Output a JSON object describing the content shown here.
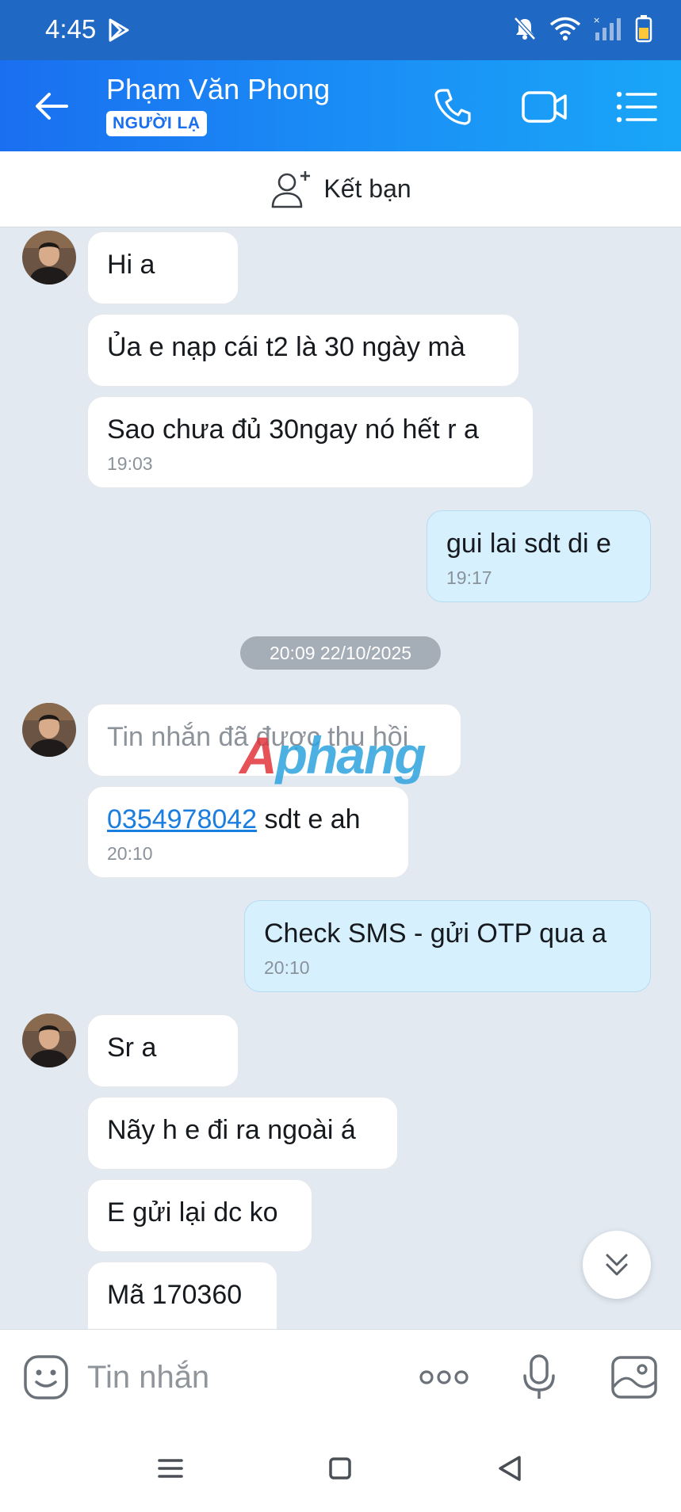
{
  "status_bar": {
    "time": "4:45"
  },
  "header": {
    "contact_name": "Phạm Văn Phong",
    "badge": "NGƯỜI LẠ"
  },
  "add_friend": {
    "label": "Kết bạn"
  },
  "date_divider": "20:09 22/10/2025",
  "messages": [
    {
      "text": "Hi a"
    },
    {
      "text": "Ủa e nạp cái t2 là 30 ngày mà"
    },
    {
      "text": "Sao chưa đủ 30ngay nó hết r a",
      "time": "19:03"
    },
    {
      "text": "gui lai sdt di e",
      "time": "19:17"
    },
    {
      "text": "Tin nhắn đã được thu hồi"
    },
    {
      "phone": "0354978042",
      "text": " sdt e ah",
      "time": "20:10"
    },
    {
      "text": "Check SMS - gửi OTP qua a",
      "time": "20:10"
    },
    {
      "text": "Sr a"
    },
    {
      "text": "Nãy h e đi ra ngoài á"
    },
    {
      "text": "E gửi lại dc ko"
    },
    {
      "text": "Mã 170360"
    }
  ],
  "watermark": {
    "first": "A",
    "rest": "phang"
  },
  "composer": {
    "placeholder": "Tin nhắn"
  },
  "colors": {
    "header_start": "#1a6ff0",
    "header_end": "#19a6f8",
    "outgoing_bubble": "#d6f0fe",
    "chat_background": "#e2e9f1"
  }
}
